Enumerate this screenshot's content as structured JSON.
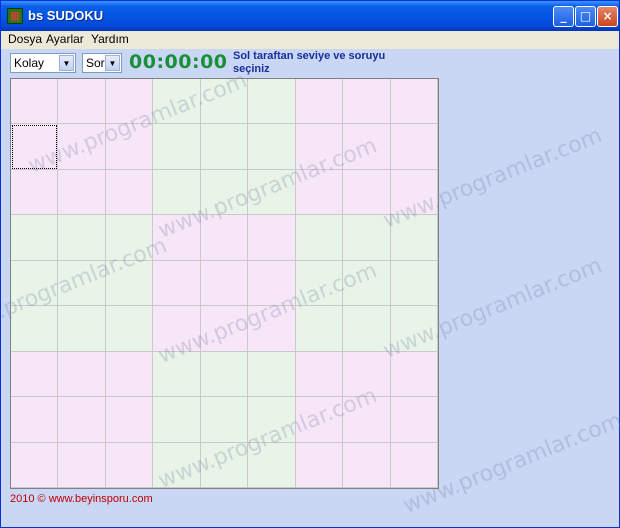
{
  "window": {
    "title": "bs SUDOKU",
    "icon": "sudoku-app-icon",
    "minimize": "_",
    "maximize": "□",
    "close": "×"
  },
  "menu": [
    "Dosya",
    "Ayarlar",
    "Yardım"
  ],
  "toolbar": {
    "level": "Kolay",
    "question": "Soru",
    "timer": "00:00:00",
    "hint": "Sol taraftan seviye ve soruyu seçiniz"
  },
  "board": {
    "rows": 9,
    "cols": 9,
    "selected_cell": [
      1,
      0
    ]
  },
  "colors": {
    "pink": "#f7e6f7",
    "green": "#e8f4e8",
    "timer": "#1a8f3a",
    "hint": "#1a2e9a",
    "footer": "#c00000"
  },
  "watermark": "www.programlar.com",
  "footer": "2010 © www.beyinsporu.com"
}
